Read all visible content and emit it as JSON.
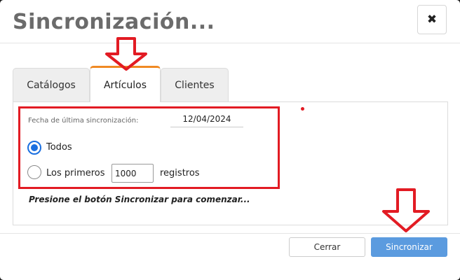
{
  "dialog": {
    "title": "Sincronización..."
  },
  "header": {
    "close_icon": "close-icon",
    "close_glyph": "✖"
  },
  "tabs": [
    {
      "label": "Catálogos",
      "active": false
    },
    {
      "label": "Artículos",
      "active": true
    },
    {
      "label": "Clientes",
      "active": false
    }
  ],
  "form": {
    "last_sync_label": "Fecha de última sincronización:",
    "last_sync_value": "12/04/2024",
    "option_all_label": "Todos",
    "option_first_label": "Los primeros",
    "first_count_value": "1000",
    "records_label": "registros",
    "selected_option": "Todos",
    "hint": "Presione el botón Sincronizar para comenzar..."
  },
  "footer": {
    "cancel_label": "Cerrar",
    "sync_label": "Sincronizar"
  },
  "colors": {
    "accent_tab": "#f08a24",
    "radio_selected": "#1a6fe0",
    "primary_button": "#5b9bdf",
    "annotation_red": "#e21b23"
  }
}
